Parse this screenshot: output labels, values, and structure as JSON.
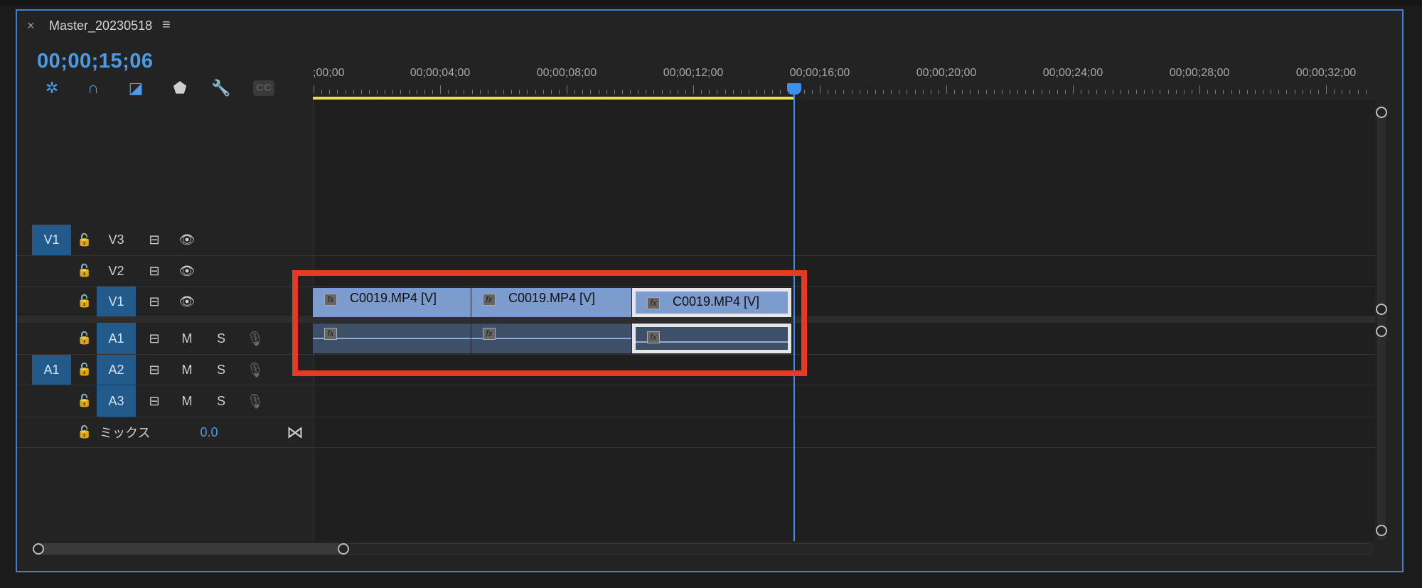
{
  "panel": {
    "title": "Master_20230518",
    "close_icon": "×",
    "menu_icon": "≡"
  },
  "timecode": "00;00;15;06",
  "toolbar": [
    {
      "name": "nest-sequence-icon",
      "glyph": "✲",
      "color": "#4b9be6"
    },
    {
      "name": "snap-magnet-icon",
      "glyph": "∩",
      "color": "#4b9be6"
    },
    {
      "name": "linked-selection-icon",
      "glyph": "◪",
      "color": "#4b9be6"
    },
    {
      "name": "add-marker-icon",
      "glyph": "⬟",
      "color": "#cfcfcf"
    },
    {
      "name": "timeline-settings-wrench-icon",
      "glyph": "🔧",
      "color": "#cfcfcf"
    },
    {
      "name": "captions-cc-icon",
      "glyph": "CC",
      "color": "#555555"
    }
  ],
  "ruler": {
    "labels": [
      {
        "text": ";00;00",
        "t": 0
      },
      {
        "text": "00;00;04;00",
        "t": 4
      },
      {
        "text": "00;00;08;00",
        "t": 8
      },
      {
        "text": "00;00;12;00",
        "t": 12
      },
      {
        "text": "00;00;16;00",
        "t": 16
      },
      {
        "text": "00;00;20;00",
        "t": 20
      },
      {
        "text": "00;00;24;00",
        "t": 24
      },
      {
        "text": "00;00;28;00",
        "t": 28
      },
      {
        "text": "00;00;32;00",
        "t": 32
      }
    ],
    "playhead_seconds": 15.2,
    "work_area_end_seconds": 15.2
  },
  "tracks": {
    "v3": {
      "source": "V1",
      "label": "V3"
    },
    "v2": {
      "label": "V2"
    },
    "v1": {
      "label": "V1"
    },
    "a1": {
      "label": "A1",
      "m": "M",
      "s": "S"
    },
    "a2": {
      "source": "A1",
      "label": "A2",
      "m": "M",
      "s": "S"
    },
    "a3": {
      "label": "A3",
      "m": "M",
      "s": "S"
    },
    "mix": {
      "label": "ミックス",
      "value": "0.0"
    }
  },
  "icons": {
    "lock": "🔓",
    "sync": "⊟",
    "eye": "👁",
    "mic": "🎙",
    "bowtie": "⋈"
  },
  "clips": [
    {
      "name": "C0019.MP4 [V]",
      "fx": "fx",
      "selected": false
    },
    {
      "name": "C0019.MP4 [V]",
      "fx": "fx",
      "selected": false
    },
    {
      "name": "C0019.MP4 [V]",
      "fx": "fx",
      "selected": true
    }
  ],
  "colors": {
    "accent": "#4b9be6",
    "highlight": "#e63a23",
    "video_clip": "#7b9ccc",
    "audio_clip": "#3e4f68"
  }
}
